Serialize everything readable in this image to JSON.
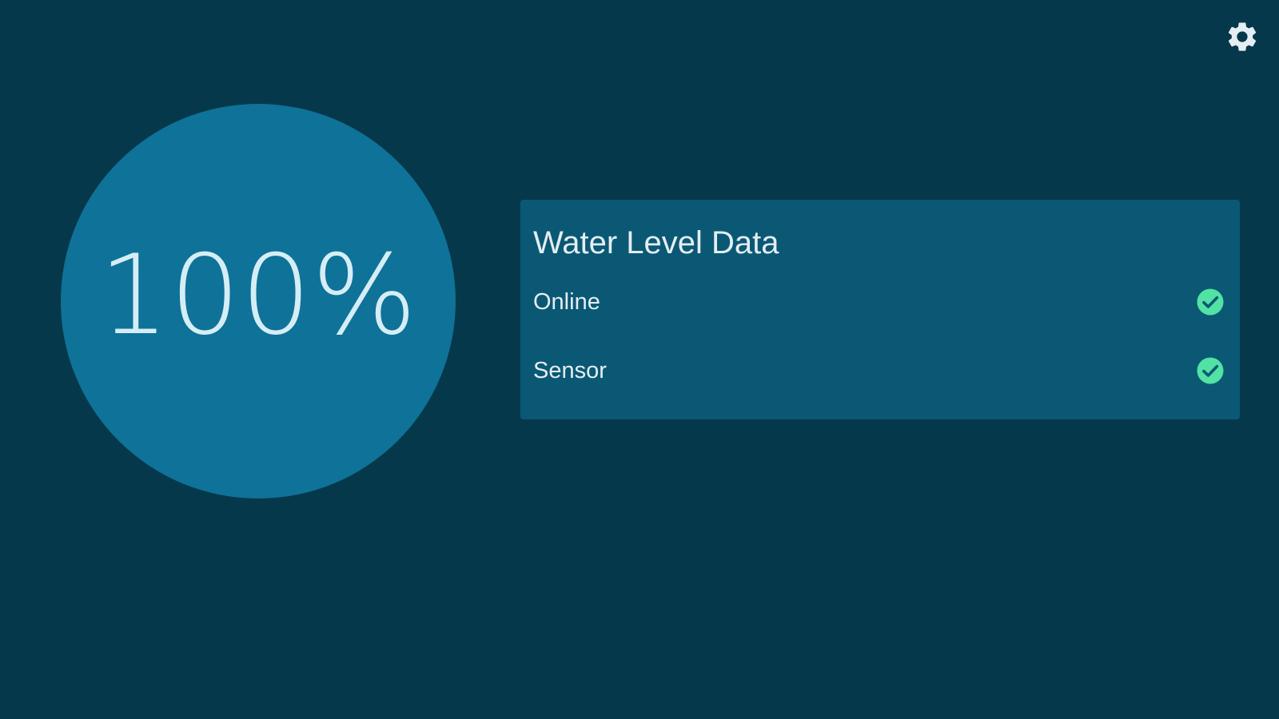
{
  "level": {
    "value_text": "100%",
    "percent": 100
  },
  "panel": {
    "title": "Water Level Data",
    "rows": [
      {
        "label": "Online",
        "icon": "check-circle-icon",
        "status": "ok"
      },
      {
        "label": "Sensor",
        "icon": "check-circle-icon",
        "status": "ok"
      }
    ]
  },
  "header": {
    "settings_icon": "gear-icon"
  },
  "colors": {
    "background": "#06384b",
    "circle": "#0f7298",
    "panel": "#0b5874",
    "check": "#52e3a4",
    "text": "#e3eef3"
  }
}
